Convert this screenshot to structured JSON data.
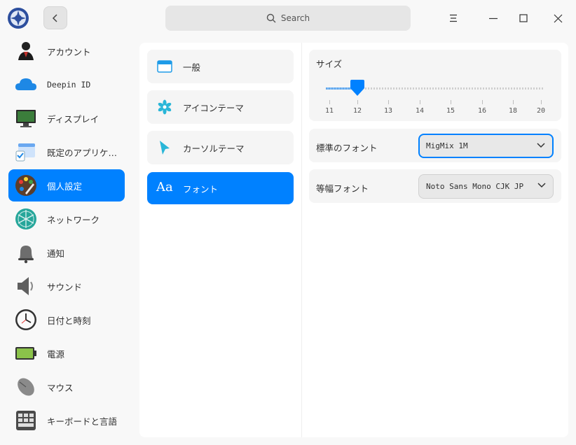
{
  "titlebar": {
    "search_placeholder": "Search"
  },
  "sidebar": {
    "items": [
      {
        "label": "アカウント",
        "icon": "account-icon"
      },
      {
        "label": "Deepin ID",
        "icon": "cloud-icon"
      },
      {
        "label": "ディスプレイ",
        "icon": "display-icon"
      },
      {
        "label": "既定のアプリケーション",
        "icon": "default-apps-icon"
      },
      {
        "label": "個人設定",
        "icon": "personalization-icon",
        "active": true
      },
      {
        "label": "ネットワーク",
        "icon": "network-icon"
      },
      {
        "label": "通知",
        "icon": "bell-icon"
      },
      {
        "label": "サウンド",
        "icon": "speaker-icon"
      },
      {
        "label": "日付と時刻",
        "icon": "clock-icon"
      },
      {
        "label": "電源",
        "icon": "battery-icon"
      },
      {
        "label": "マウス",
        "icon": "mouse-icon"
      },
      {
        "label": "キーボードと言語",
        "icon": "keyboard-icon"
      }
    ]
  },
  "categories": [
    {
      "label": "一般",
      "icon": "window-icon"
    },
    {
      "label": "アイコンテーマ",
      "icon": "icon-theme-icon"
    },
    {
      "label": "カーソルテーマ",
      "icon": "cursor-icon"
    },
    {
      "label": "フォント",
      "icon": "font-icon",
      "glyph": "Aa",
      "active": true
    }
  ],
  "font_settings": {
    "size_label": "サイズ",
    "size_ticks": [
      "11",
      "12",
      "13",
      "14",
      "15",
      "16",
      "18",
      "20"
    ],
    "size_value": "12",
    "standard_font_label": "標準のフォント",
    "standard_font_value": "MigMix 1M",
    "mono_font_label": "等幅フォント",
    "mono_font_value": "Noto Sans Mono CJK JP"
  },
  "colors": {
    "accent": "#0081ff",
    "background": "#f8f8f8",
    "panel": "#ffffff",
    "card": "#f5f5f5"
  }
}
